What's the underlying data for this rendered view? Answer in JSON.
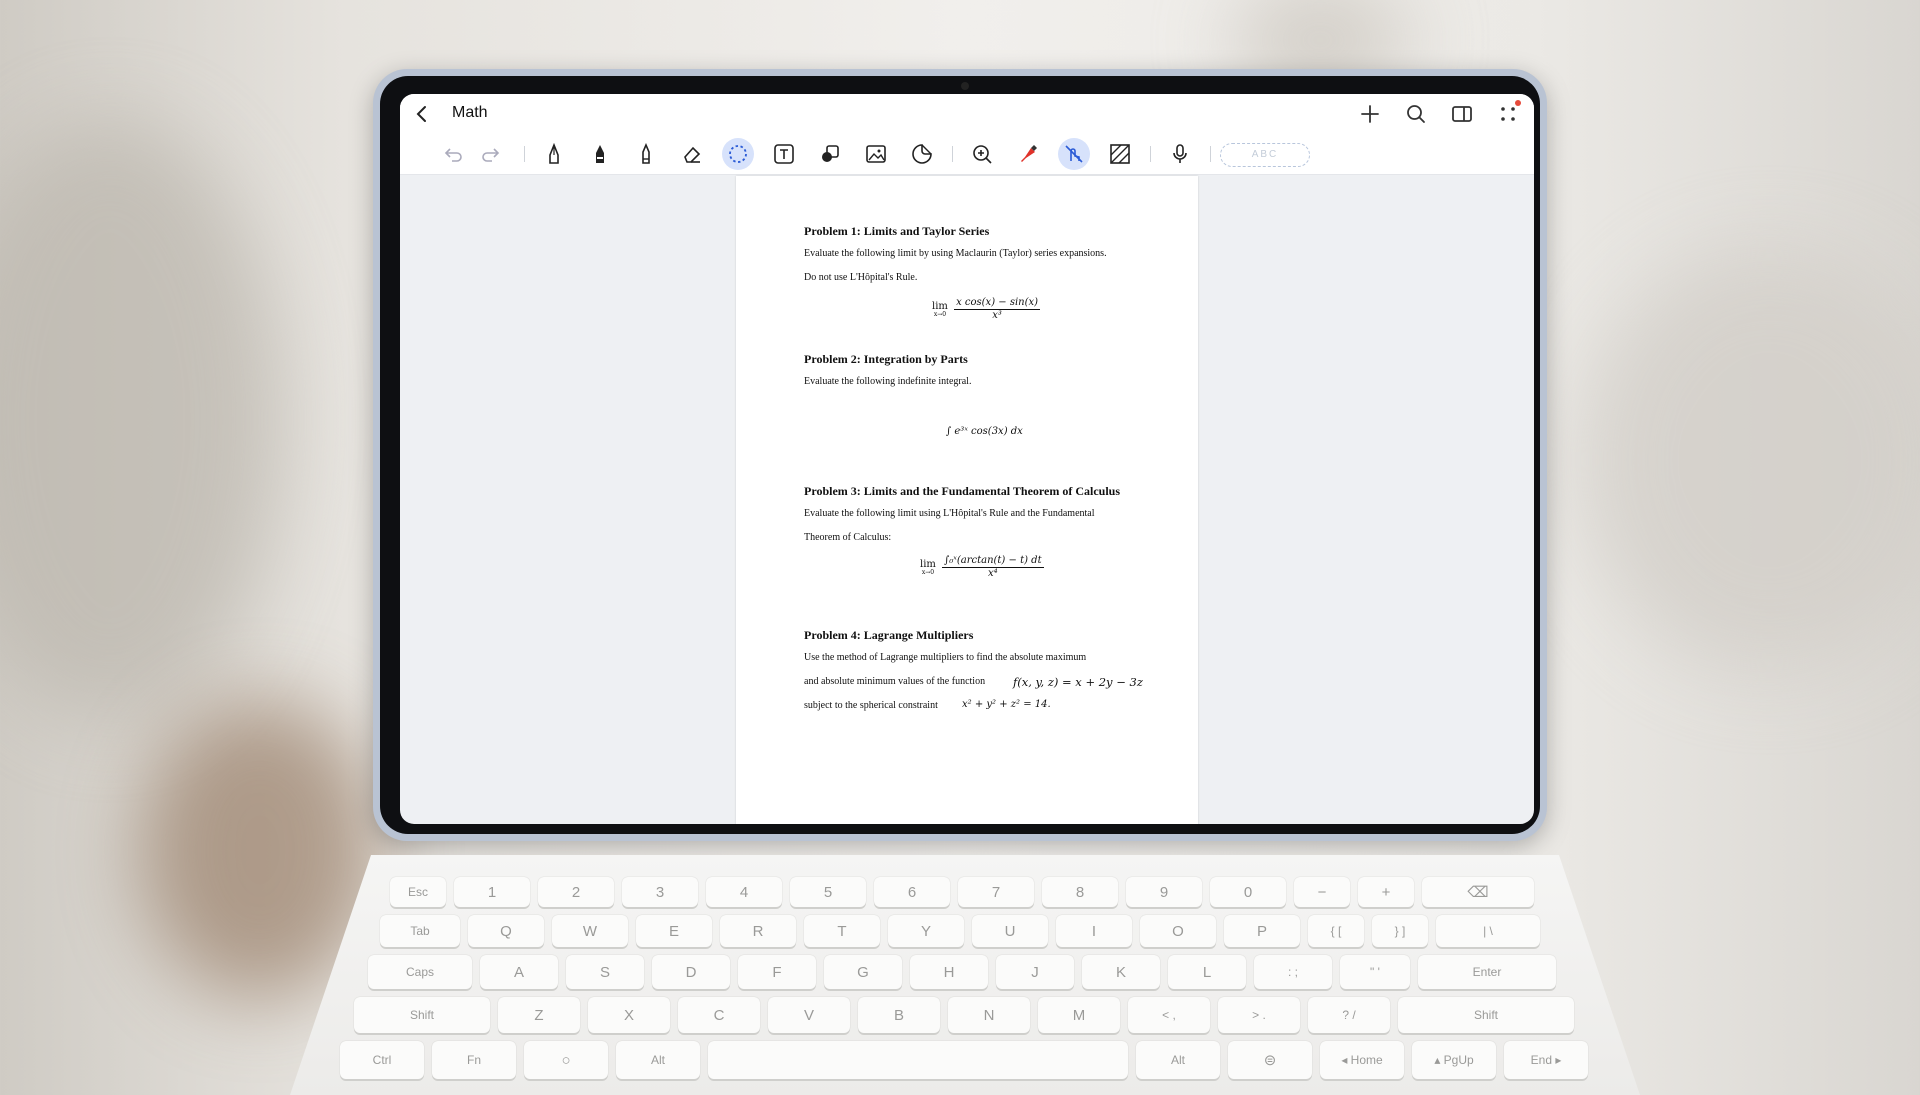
{
  "app": {
    "title": "Math"
  },
  "toolbar": {
    "handwriting_placeholder": "ABC",
    "tools": [
      "undo-icon",
      "redo-icon",
      "pen-icon",
      "fountain-pen-icon",
      "pencil-icon",
      "eraser-icon",
      "lasso-icon",
      "text-box-icon",
      "shapes-icon",
      "image-icon",
      "sticker-icon",
      "zoom-in-icon",
      "highlighter-icon",
      "touch-draw-icon",
      "paper-texture-icon",
      "microphone-icon"
    ],
    "active_tools": [
      "lasso-icon",
      "touch-draw-icon"
    ]
  },
  "titlebar_actions": [
    "add-icon",
    "search-icon",
    "split-view-icon",
    "more-icon"
  ],
  "document": {
    "p1": {
      "title": "Problem 1: Limits and Taylor Series",
      "line1": "Evaluate the following limit by using Maclaurin (Taylor) series expansions.",
      "line2": "Do not use L'Hôpital's Rule.",
      "formula_lim": "lim",
      "formula_sub": "x→0",
      "formula_num": "x cos(x) − sin(x)",
      "formula_den": "x³"
    },
    "p2": {
      "title": "Problem 2: Integration by Parts",
      "line1": "Evaluate the following indefinite integral.",
      "formula": "∫ e³ˣ cos(3x) dx"
    },
    "p3": {
      "title": "Problem 3: Limits and the Fundamental Theorem of Calculus",
      "line1": "Evaluate the following limit using L'Hôpital's Rule and the Fundamental",
      "line2": "Theorem of Calculus:",
      "formula_lim": "lim",
      "formula_sub": "x→0",
      "formula_num": "∫₀ˣ(arctan(t) − t) dt",
      "formula_den": "x⁴"
    },
    "p4": {
      "title": "Problem 4: Lagrange Multipliers",
      "line1": "Use the method of Lagrange multipliers to find the absolute maximum",
      "line2": "and absolute minimum values of the function",
      "function": "f(x, y, z) = x + 2y − 3z",
      "line3": "subject to the spherical constraint",
      "constraint": "x² + y² + z² = 14."
    }
  },
  "keyboard": {
    "row1": [
      "Esc",
      "1",
      "2",
      "3",
      "4",
      "5",
      "6",
      "7",
      "8",
      "9",
      "0",
      "−",
      "+",
      "⌫"
    ],
    "row2": [
      "Tab",
      "Q",
      "W",
      "E",
      "R",
      "T",
      "Y",
      "U",
      "I",
      "O",
      "P",
      "{ [",
      "} ]",
      "| \\"
    ],
    "row3": [
      "Caps",
      "A",
      "S",
      "D",
      "F",
      "G",
      "H",
      "J",
      "K",
      "L",
      ": ;",
      "\" '",
      "Enter"
    ],
    "row4": [
      "Shift",
      "Z",
      "X",
      "C",
      "V",
      "B",
      "N",
      "M",
      "< ,",
      "> .",
      "? /",
      "Shift"
    ],
    "row5": [
      "Ctrl",
      "Fn",
      "○",
      "Alt",
      "",
      "Alt",
      "⊜",
      "◂ Home",
      "▴ PgUp",
      "End ▸"
    ]
  }
}
